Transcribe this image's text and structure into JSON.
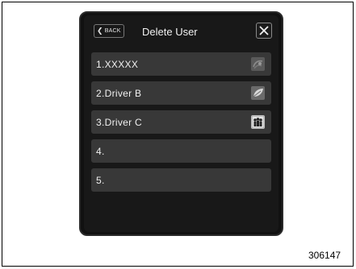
{
  "header": {
    "back_label": "BACK",
    "title": "Delete User"
  },
  "users": [
    {
      "label": "1.XXXXX",
      "icon": "abstract-avatar-icon"
    },
    {
      "label": "2.Driver B",
      "icon": "leaf-avatar-icon"
    },
    {
      "label": "3.Driver C",
      "icon": "family-avatar-icon"
    },
    {
      "label": "4."
    },
    {
      "label": "5."
    }
  ],
  "figure_id": "306147",
  "colors": {
    "screen_bg": "#181818",
    "row_bg": "#383838",
    "text": "#f0f0f0"
  }
}
